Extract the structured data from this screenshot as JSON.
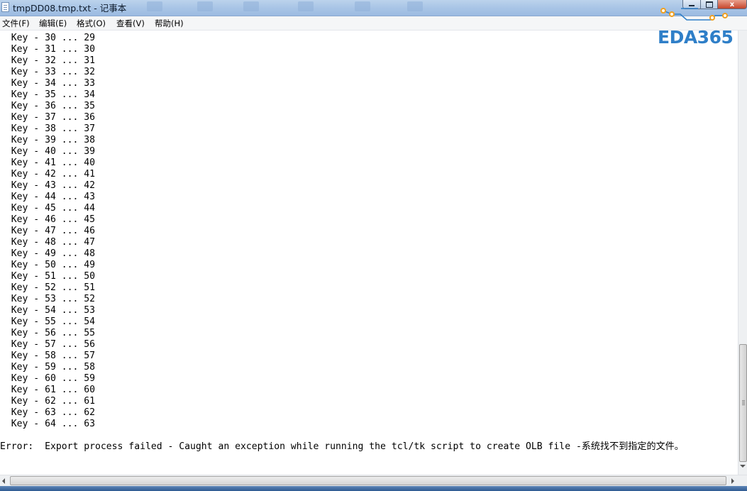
{
  "window": {
    "title": "tmpDD08.tmp.txt - 记事本",
    "minimize_label": "",
    "maximize_label": "",
    "close_label": "x"
  },
  "menu": [
    {
      "label": "文件(F)"
    },
    {
      "label": "编辑(E)"
    },
    {
      "label": "格式(O)"
    },
    {
      "label": "查看(V)"
    },
    {
      "label": "帮助(H)"
    }
  ],
  "editor": {
    "lines": [
      "  Key - 30 ... 29",
      "  Key - 31 ... 30",
      "  Key - 32 ... 31",
      "  Key - 33 ... 32",
      "  Key - 34 ... 33",
      "  Key - 35 ... 34",
      "  Key - 36 ... 35",
      "  Key - 37 ... 36",
      "  Key - 38 ... 37",
      "  Key - 39 ... 38",
      "  Key - 40 ... 39",
      "  Key - 41 ... 40",
      "  Key - 42 ... 41",
      "  Key - 43 ... 42",
      "  Key - 44 ... 43",
      "  Key - 45 ... 44",
      "  Key - 46 ... 45",
      "  Key - 47 ... 46",
      "  Key - 48 ... 47",
      "  Key - 49 ... 48",
      "  Key - 50 ... 49",
      "  Key - 51 ... 50",
      "  Key - 52 ... 51",
      "  Key - 53 ... 52",
      "  Key - 54 ... 53",
      "  Key - 55 ... 54",
      "  Key - 56 ... 55",
      "  Key - 57 ... 56",
      "  Key - 58 ... 57",
      "  Key - 59 ... 58",
      "  Key - 60 ... 59",
      "  Key - 61 ... 60",
      "  Key - 62 ... 61",
      "  Key - 63 ... 62",
      "  Key - 64 ... 63",
      "",
      "Error:  Export process failed - Caught an exception while running the tcl/tk script to create OLB file -系统找不到指定的文件。"
    ]
  },
  "watermark": {
    "text": "EDA365",
    "color": "#2f7fc8",
    "accent": "#f0a020"
  },
  "colors": {
    "titlebar": "#a9c5e6",
    "menubar": "#f5f6f7",
    "close_button": "#c5452b",
    "taskbar": "#2f5a92"
  }
}
